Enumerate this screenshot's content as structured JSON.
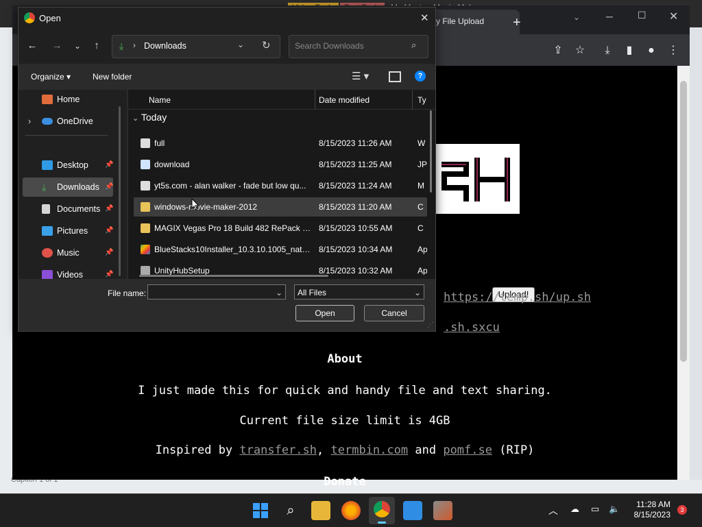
{
  "background": {
    "caption_text": "Caption 1 of 1",
    "tab_fragments": [
      "Video Tools",
      "Text Tools",
      "My Movie - Movie Maker"
    ]
  },
  "browser": {
    "active_tab_title": "ry File Upload",
    "new_tab_symbol": "+",
    "accent": "#8ab4f8"
  },
  "page": {
    "partial_heading": "sh",
    "upload_label": "Upload!",
    "url_link": "https://temp.sh/up.sh",
    "sxcu_link": ".sh.sxcu",
    "about_heading": "About",
    "about_line": "I just made this for quick and handy file and text sharing.",
    "limit_line": "Current file size limit is 4GB",
    "inspired_prefix": "Inspired by",
    "inspired_link1": "transfer.sh",
    "inspired_comma": ",",
    "inspired_link2": "termbin.com",
    "inspired_and": "and",
    "inspired_link3": "pomf.se",
    "inspired_suffix": "(RIP)",
    "donate_heading": "Donate"
  },
  "dialog": {
    "title": "Open",
    "breadcrumb": "Downloads",
    "search_placeholder": "Search Downloads",
    "organize_label": "Organize",
    "new_folder_label": "New folder",
    "column_name": "Name",
    "column_date": "Date modified",
    "column_type": "Ty",
    "group_label": "Today",
    "nav_items": [
      {
        "label": "Home",
        "icon": "home-icon",
        "pinned": false
      },
      {
        "label": "OneDrive",
        "icon": "cloud-icon",
        "pinned": false
      },
      {
        "label": "Desktop",
        "icon": "desktop-icon",
        "pinned": true
      },
      {
        "label": "Downloads",
        "icon": "download-icon",
        "pinned": true
      },
      {
        "label": "Documents",
        "icon": "document-icon",
        "pinned": true
      },
      {
        "label": "Pictures",
        "icon": "pictures-icon",
        "pinned": true
      },
      {
        "label": "Music",
        "icon": "music-icon",
        "pinned": true
      },
      {
        "label": "Videos",
        "icon": "videos-icon",
        "pinned": true
      }
    ],
    "files": [
      {
        "name": "full",
        "date": "8/15/2023 11:26 AM",
        "type": "W"
      },
      {
        "name": "download",
        "date": "8/15/2023 11:25 AM",
        "type": "JP"
      },
      {
        "name": "yt5s.com - alan walker - fade but low qu...",
        "date": "8/15/2023 11:24 AM",
        "type": "M"
      },
      {
        "name": "windows-movie-maker-2012",
        "date": "8/15/2023 11:20 AM",
        "type": "C"
      },
      {
        "name": "MAGIX Vegas Pro 18 Build 482 RePack by ...",
        "date": "8/15/2023 10:55 AM",
        "type": "C"
      },
      {
        "name": "BlueStacks10Installer_10.3.10.1005_native...",
        "date": "8/15/2023 10:34 AM",
        "type": "Ap"
      },
      {
        "name": "UnityHubSetup",
        "date": "8/15/2023 10:32 AM",
        "type": "Ap"
      }
    ],
    "file_name_label": "File name:",
    "file_name_value": "",
    "filter_value": "All Files",
    "open_label": "Open",
    "cancel_label": "Cancel",
    "accent": "#0078d4"
  },
  "taskbar": {
    "time": "11:28 AM",
    "date": "8/15/2023",
    "notification_count": "3"
  }
}
